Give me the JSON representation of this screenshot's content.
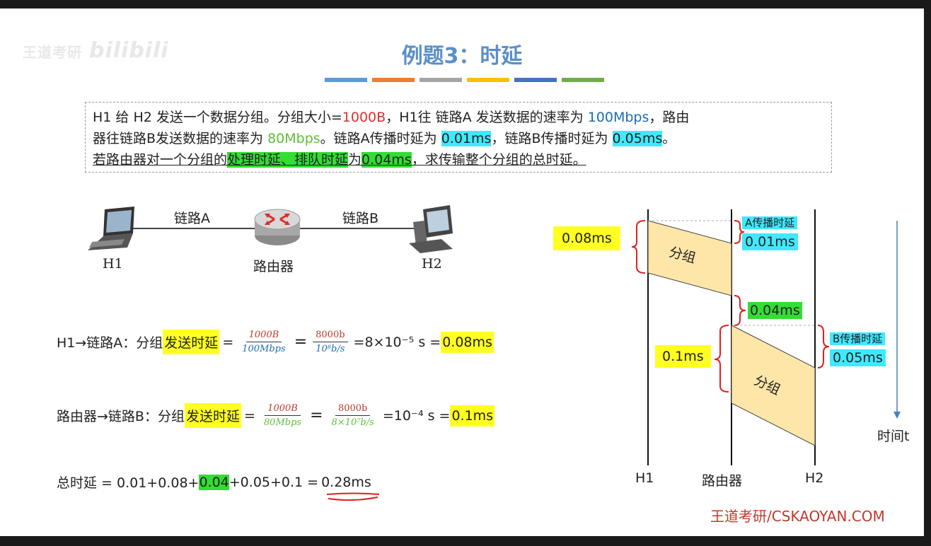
{
  "watermark": {
    "left": "王道考研",
    "right": "bilibili"
  },
  "title": "例题3：时延",
  "colorbars": [
    "#5b9bd5",
    "#ed7d31",
    "#a5a5a5",
    "#ffc000",
    "#4472c4",
    "#70ad47"
  ],
  "problem": {
    "l1_a": "H1 给 H2 发送一个数据分组。分组大小=",
    "l1_size": "1000B",
    "l1_b": "，H1往 链路A 发送数据的速率为 ",
    "l1_rate": "100Mbps",
    "l1_c": "，路由",
    "l2_a": "器往链路B发送数据的速率为 ",
    "l2_rate": "80Mbps",
    "l2_b": "。链路A传播时延为 ",
    "l2_pa": "0.01ms",
    "l2_c": "，链路B传播时延为 ",
    "l2_pb": "0.05ms",
    "l2_d": "。",
    "l3_a": "若路由器对一个分组的",
    "l3_proc": "处理时延、排队时延",
    "l3_b": "为",
    "l3_val": "0.04ms",
    "l3_c": "，求传输整个分组的总时延。"
  },
  "topology": {
    "link_a": "链路A",
    "link_b": "链路B",
    "h1": "H1",
    "router": "路由器",
    "h2": "H2"
  },
  "eq1": {
    "prefix": "H1→链路A：分组",
    "term": "发送时延",
    "eq": "=",
    "f1_num": "1000B",
    "f1_den": "100Mbps",
    "f2_num": "8000b",
    "f2_den": "10⁸b/s",
    "result": "=8×10⁻⁵ s = ",
    "answer": "0.08ms"
  },
  "eq2": {
    "prefix": "路由器→链路B：分组",
    "term": "发送时延",
    "eq": "=",
    "f1_num": "1000B",
    "f1_den": "80Mbps",
    "f2_num": "8000b",
    "f2_den": "8×10⁷b/s",
    "result": "=10⁻⁴ s = ",
    "answer": "0.1ms"
  },
  "eq3": {
    "prefix": "总时延 = 0.01+0.08+",
    "proc": "0.04",
    "rest": "+0.05+0.1 = ",
    "total": "0.28ms"
  },
  "timing": {
    "send_a": "0.08ms",
    "prop_a_label": "A传播时延",
    "prop_a": "0.01ms",
    "packet1": "分组",
    "proc": "0.04ms",
    "send_b": "0.1ms",
    "prop_b_label": "B传播时延",
    "prop_b": "0.05ms",
    "packet2": "分组",
    "time_axis": "时间t",
    "col_h1": "H1",
    "col_router": "路由器",
    "col_h2": "H2"
  },
  "footer": "王道考研/CSKAOYAN.COM"
}
